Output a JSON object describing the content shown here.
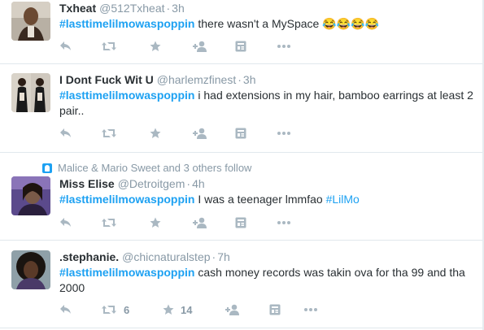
{
  "tweets": [
    {
      "fullname": "Txheat",
      "handle": "@512Txheat",
      "time": "3h",
      "hashtag": "#lasttimelilmowaspoppin",
      "text": " there wasn't a MySpace ",
      "emoji": "😂😂😂😂",
      "retweets": "",
      "favorites": ""
    },
    {
      "fullname": "I Dont Fuck Wit U",
      "handle": "@harlemzfinest",
      "time": "3h",
      "hashtag": "#lasttimelilmowaspoppin",
      "text": " i had extensions in my hair, bamboo earrings at least 2 pair..",
      "retweets": "",
      "favorites": ""
    },
    {
      "context": "Malice & Mario Sweet and 3 others follow",
      "fullname": "Miss Elise",
      "handle": "@Detroitgem",
      "time": "4h",
      "hashtag": "#lasttimelilmowaspoppin",
      "text": " I was a teenager lmmfao ",
      "hashtag2": "#LilMo",
      "retweets": "",
      "favorites": ""
    },
    {
      "fullname": ".stephanie.",
      "handle": "@chicnaturalstep",
      "time": "7h",
      "hashtag": "#lasttimelilmowaspoppin",
      "text": " cash money records was takin ova for tha 99 and tha 2000",
      "retweets": "6",
      "favorites": "14"
    }
  ],
  "separator": "·",
  "icons": [
    "reply-icon",
    "retweet-icon",
    "favorite-icon",
    "follow-icon",
    "media-icon",
    "more-icon"
  ],
  "colors": {
    "accent": "#1da1f2",
    "muted": "#8899a6",
    "icon": "#aab8c2",
    "divider": "#e1e8ed"
  }
}
